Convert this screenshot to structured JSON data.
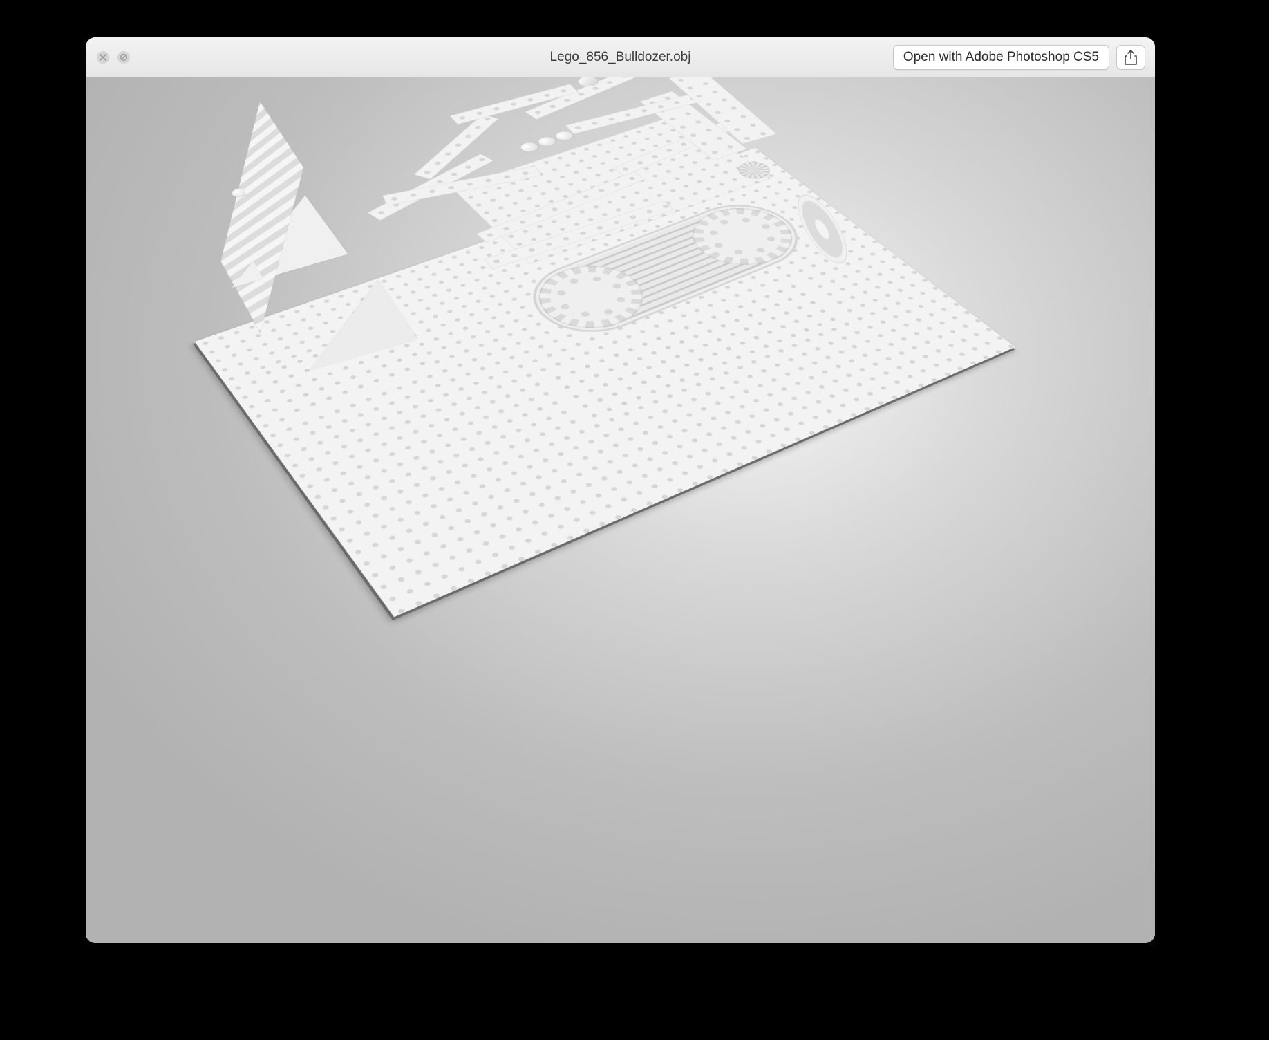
{
  "window": {
    "title": "Lego_856_Bulldozer.obj",
    "open_with_label": "Open with Adobe Photoshop CS5"
  },
  "icons": {
    "close": "close-icon",
    "stop": "stop-icon",
    "share": "share-icon"
  },
  "preview": {
    "model_description": "Untextured 3D LEGO bulldozer model on a studded baseplate, rendered in greyscale Quick Look preview"
  }
}
